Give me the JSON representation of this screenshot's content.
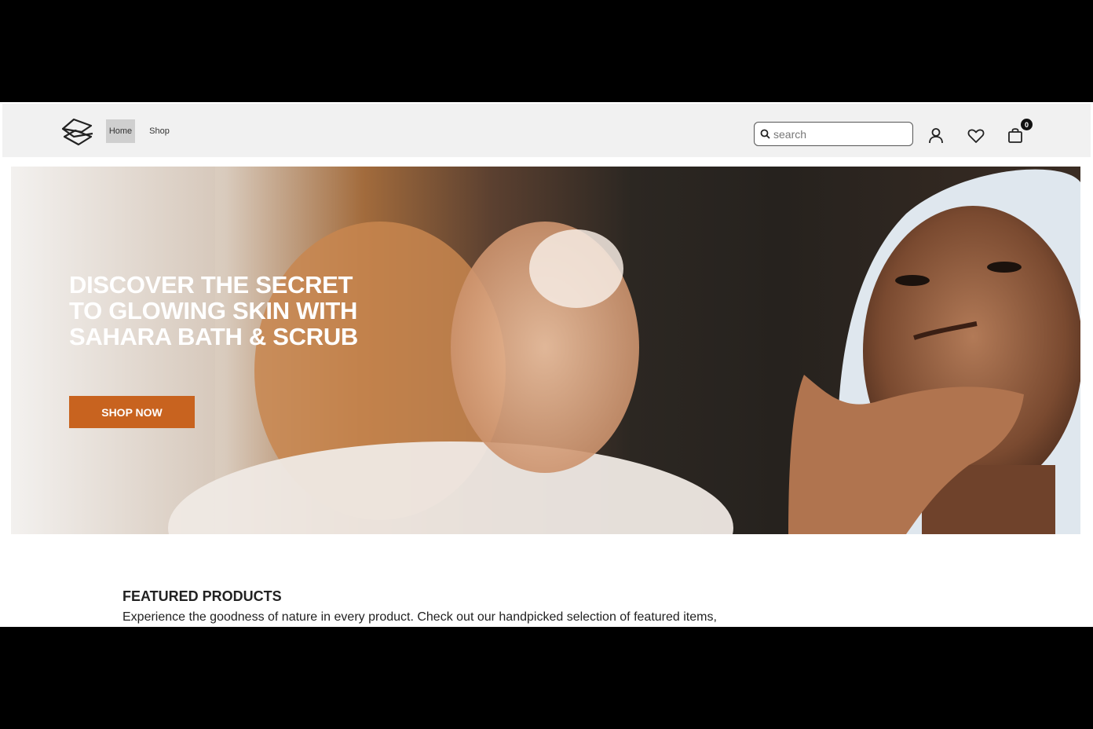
{
  "header": {
    "logo": "brand-logo-icon",
    "nav": [
      {
        "label": "Home",
        "active": true
      },
      {
        "label": "Shop",
        "active": false
      }
    ],
    "search": {
      "placeholder": "search",
      "value": ""
    },
    "icons": [
      "user-icon",
      "heart-icon",
      "shopping-bag-icon"
    ],
    "cart_count": "0"
  },
  "hero": {
    "title": "DISCOVER THE SECRET TO GLOWING SKIN WITH SAHARA BATH & SCRUB",
    "cta_label": "SHOP NOW",
    "cta_color": "#c8631f"
  },
  "featured": {
    "title": "FEATURED PRODUCTS",
    "text": "Experience the goodness of nature in every product. Check out our handpicked selection of featured items,"
  }
}
